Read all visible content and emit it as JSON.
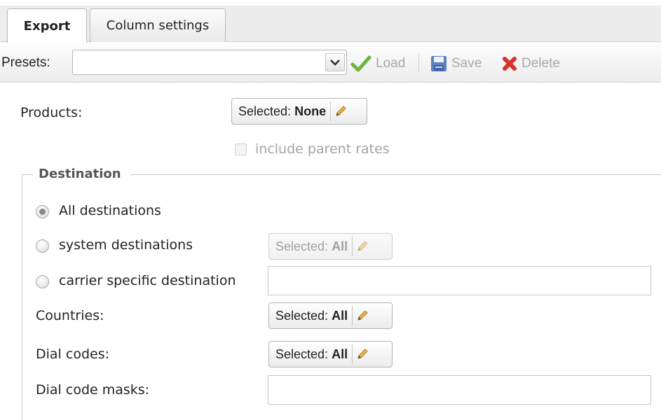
{
  "tabs": [
    {
      "label": "Export",
      "active": true
    },
    {
      "label": "Column settings",
      "active": false
    }
  ],
  "toolbar": {
    "presets_label": "Presets:",
    "preset_value": "",
    "load_label": "Load",
    "save_label": "Save",
    "delete_label": "Delete"
  },
  "products": {
    "label": "Products:",
    "selector_prefix": "Selected:",
    "selector_value": "None",
    "include_parent_rates_label": "include parent rates",
    "include_parent_rates_checked": false
  },
  "destination": {
    "legend": "Destination",
    "options": [
      {
        "label": "All destinations",
        "checked": true
      },
      {
        "label": "system destinations",
        "checked": false
      },
      {
        "label": "carrier specific destination",
        "checked": false
      }
    ],
    "system_selector_prefix": "Selected:",
    "system_selector_value": "All",
    "carrier_value": "",
    "countries_label": "Countries:",
    "countries_prefix": "Selected:",
    "countries_value": "All",
    "dial_codes_label": "Dial codes:",
    "dial_codes_prefix": "Selected:",
    "dial_codes_value": "All",
    "dial_code_masks_label": "Dial code masks:",
    "dial_code_masks_value": ""
  },
  "colors": {
    "load_check": "#6cb33f",
    "save_icon": "#5b7fbf",
    "delete_icon": "#d9322b",
    "pencil": "#d9a43a"
  },
  "icons": {
    "load": "check-icon",
    "save": "floppy-disk-icon",
    "delete": "x-icon",
    "edit": "pencil-icon",
    "dropdown": "chevron-down-icon"
  }
}
